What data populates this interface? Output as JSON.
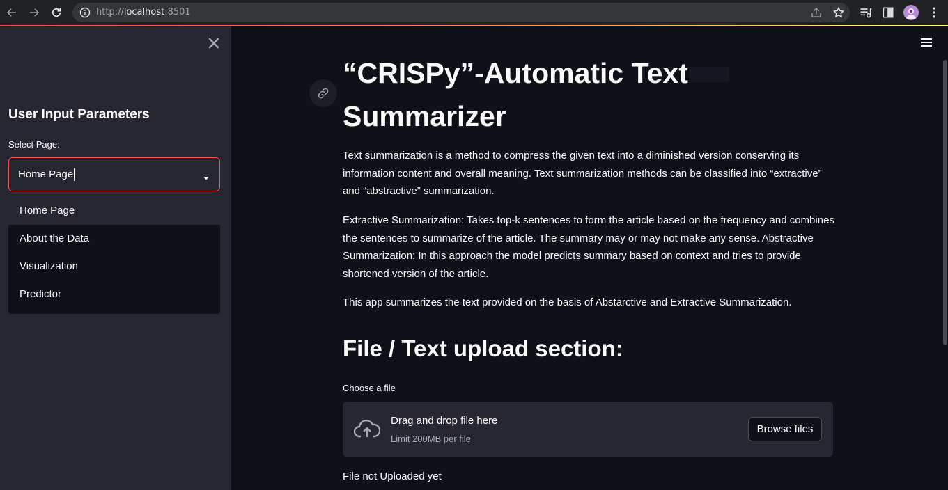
{
  "browser": {
    "url_prefix": "http://",
    "url_host": "localhost",
    "url_port": ":8501"
  },
  "sidebar": {
    "heading": "User Input Parameters",
    "select_label": "Select Page:",
    "select_value": "Home Page",
    "options": [
      "Home Page",
      "About the Data",
      "Visualization",
      "Predictor"
    ]
  },
  "main": {
    "title_line1": "“CRISPy”-Automatic Text",
    "title_line2": "Summarizer",
    "p1": "Text summarization is a method to compress the given text into a diminished version conserving its information content and overall meaning. Text summarization methods can be classified into “extractive” and “abstractive” summarization.",
    "p2": "Extractive Summarization: Takes top-k sentences to form the article based on the frequency and combines the sentences to summarize of the article. The summary may or may not make any sense. Abstractive Summarization: In this approach the model predicts summary based on context and tries to provide shortened version of the article.",
    "p3": "This app summarizes the text provided on the basis of Abstarctive and Extractive Summarization.",
    "section_heading": "File / Text upload section:",
    "choose_label": "Choose a file",
    "drag_text": "Drag and drop file here",
    "limit_text": "Limit 200MB per file",
    "browse_label": "Browse files",
    "status_text": "File not Uploaded yet"
  },
  "colors": {
    "accent": "#ff4b4b",
    "background": "#0e1117",
    "sidebar": "#262730",
    "text": "#fafafa"
  },
  "icons": [
    "back-icon",
    "forward-icon",
    "reload-icon",
    "info-icon",
    "share-icon",
    "star-icon",
    "media-icon",
    "sidepanel-icon",
    "profile-avatar",
    "more-icon",
    "close-icon",
    "chevron-down-icon",
    "hamburger-icon",
    "link-icon",
    "cloud-upload-icon"
  ]
}
